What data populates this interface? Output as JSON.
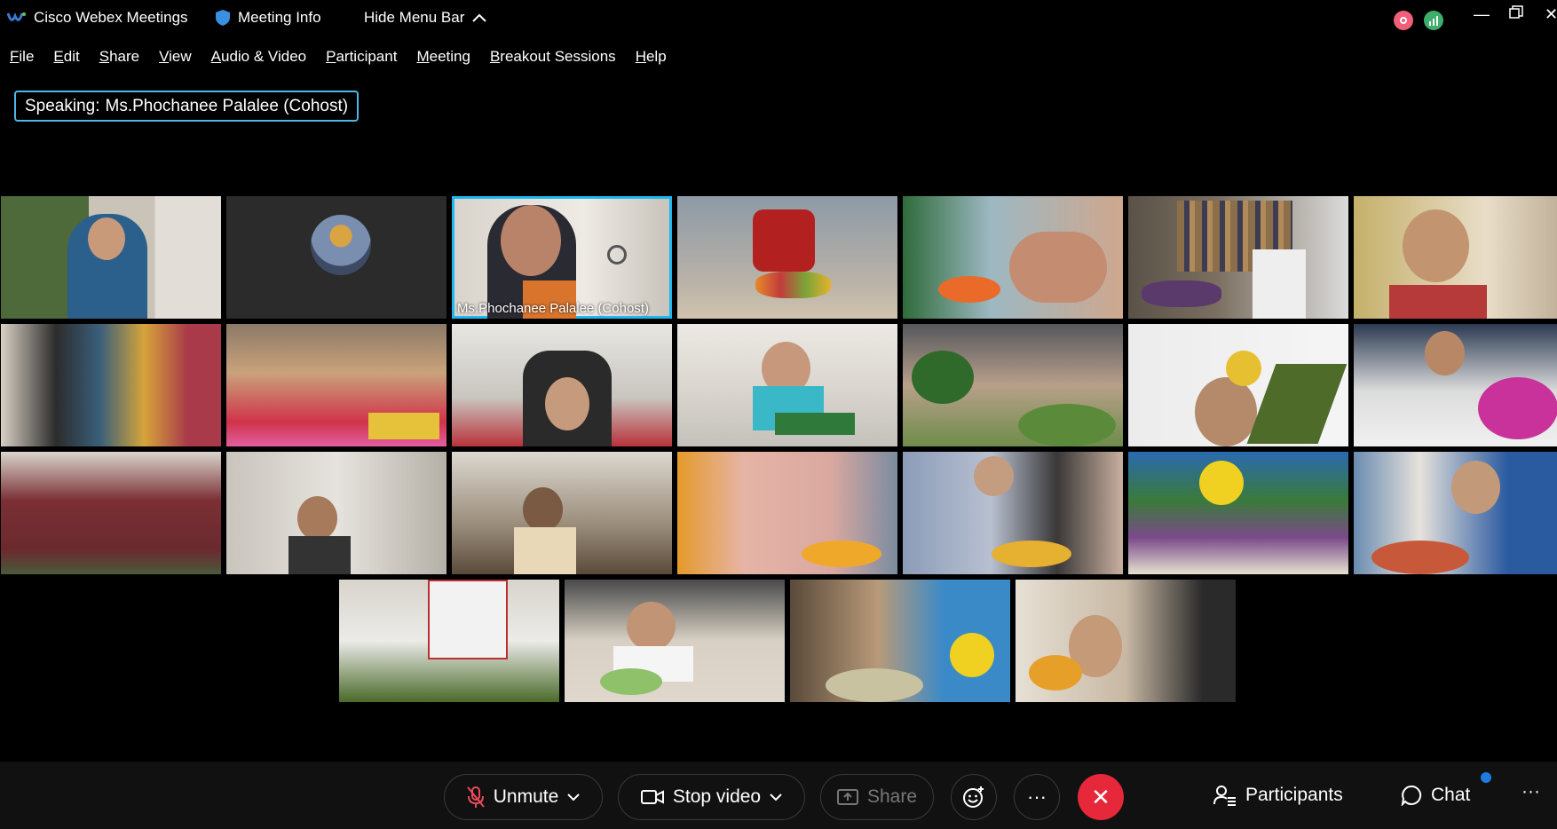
{
  "titlebar": {
    "app_name": "Cisco Webex Meetings",
    "meeting_info": "Meeting Info",
    "hide_menu": "Hide Menu Bar",
    "icons": [
      "webex-logo-icon",
      "shield-icon",
      "chevron-up-icon",
      "record-icon",
      "signal-icon",
      "minimize-icon",
      "restore-icon",
      "close-icon"
    ]
  },
  "menu": {
    "items": [
      {
        "pre": "",
        "u": "F",
        "post": "ile"
      },
      {
        "pre": "",
        "u": "E",
        "post": "dit"
      },
      {
        "pre": "",
        "u": "S",
        "post": "hare"
      },
      {
        "pre": "",
        "u": "V",
        "post": "iew"
      },
      {
        "pre": "",
        "u": "A",
        "post": "udio & Video"
      },
      {
        "pre": "",
        "u": "P",
        "post": "articipant"
      },
      {
        "pre": "",
        "u": "M",
        "post": "eeting"
      },
      {
        "pre": "",
        "u": "B",
        "post": "reakout Sessions"
      },
      {
        "pre": "",
        "u": "H",
        "post": "elp"
      }
    ]
  },
  "speaking": {
    "label": "Speaking:",
    "name": "Ms.Phochanee Palalee (Cohost)"
  },
  "participants": {
    "active_name": "Ms.Phochanee Palalee   (Cohost)"
  },
  "controls": {
    "unmute": "Unmute",
    "stop_video": "Stop video",
    "share": "Share",
    "participants": "Participants",
    "chat": "Chat",
    "more": "···",
    "end_icon": "✕"
  },
  "colors": {
    "accent": "#1fb7f0",
    "end_call": "#e6283a",
    "chat_dot": "#1e7be0"
  }
}
